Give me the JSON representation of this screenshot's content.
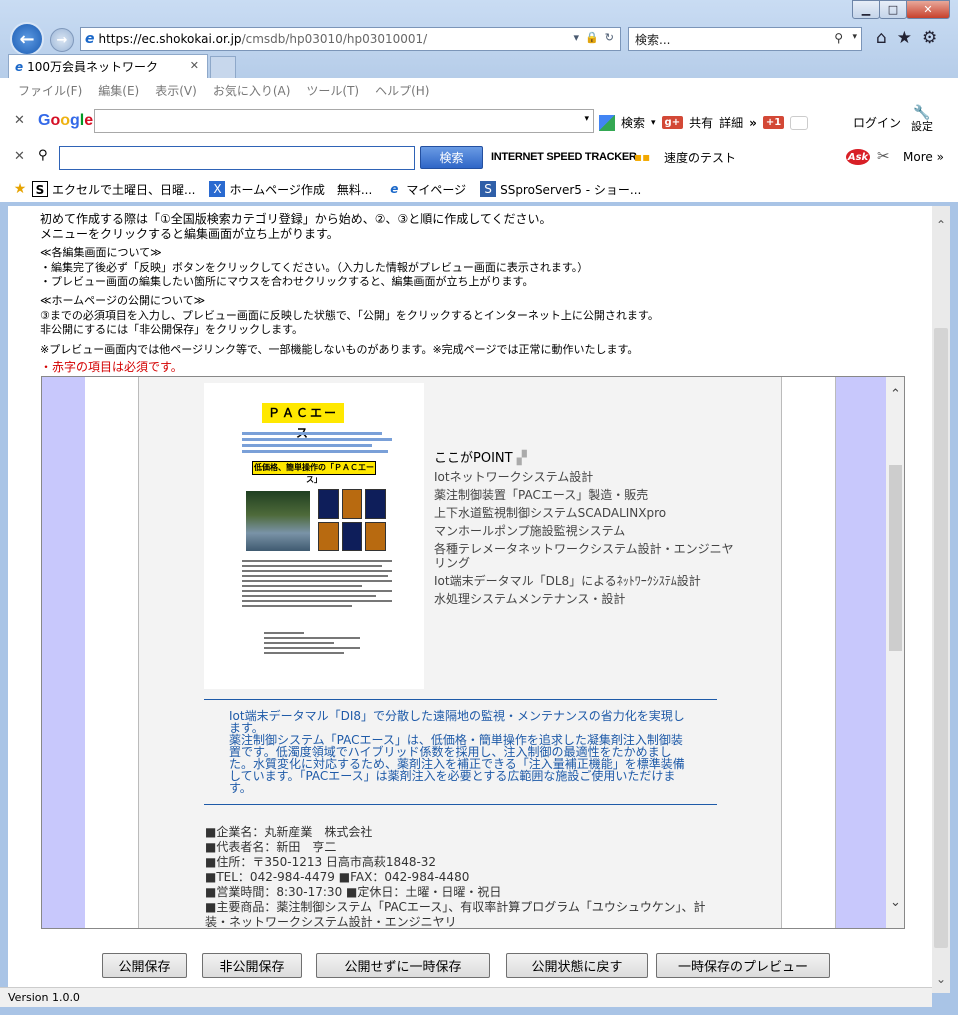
{
  "browser": {
    "url_host": "https://ec.shokokai.or.jp",
    "url_path": "/cmsdb/hp03010/hp03010001/",
    "search_placeholder": "検索...",
    "tab_title": "100万会員ネットワーク"
  },
  "menu": [
    "ファイル(F)",
    "編集(E)",
    "表示(V)",
    "お気に入り(A)",
    "ツール(T)",
    "ヘルプ(H)"
  ],
  "google_toolbar": {
    "logo": "Google",
    "search_label": "検索",
    "share_label": "共有",
    "details_label": "詳細",
    "gplus_label": "+1",
    "login_label": "ログイン",
    "settings_label": "設定"
  },
  "speed_toolbar": {
    "search_button": "検索",
    "title": "INTERNET SPEED TRACKER",
    "speed_test": "速度のテスト",
    "ask_logo": "Ask",
    "more": "More"
  },
  "favorites": [
    {
      "icon": "S",
      "label": "エクセルで土曜日、日曜..."
    },
    {
      "icon": "X",
      "label": "ホームページ作成　無料..."
    },
    {
      "icon": "e",
      "label": "マイページ"
    },
    {
      "icon": "S",
      "label": "SSproServer5 - ショー..."
    }
  ],
  "instructions": {
    "line1": "初めて作成する際は「①全国版検索カテゴリ登録」から始め、②、③と順に作成してください。",
    "line2": "メニューをクリックすると編集画面が立ち上がります。",
    "edit_head": "≪各編集画面について≫",
    "edit_1": "・編集完了後必ず「反映」ボタンをクリックしてください。（入力した情報がプレビュー画面に表示されます。）",
    "edit_2": "・プレビュー画面の編集したい箇所にマウスを合わせクリックすると、編集画面が立ち上がります。",
    "publish_head": "≪ホームページの公開について≫",
    "publish_1": "③までの必須項目を入力し、プレビュー画面に反映した状態で、「公開」をクリックするとインターネット上に公開されます。",
    "publish_2": "非公開にするには「非公開保存」をクリックします。",
    "note": "※プレビュー画面内では他ページリンク等で、一部機能しないものがあります。※完成ページでは正常に動作いたします。",
    "required": "・赤字の項目は必須です。"
  },
  "flyer": {
    "title": "ＰＡＣエース",
    "subtitle": "低価格、簡単操作の「ＰＡＣエース」"
  },
  "point": {
    "title": "ここがPOINT",
    "items": [
      "Iotネットワークシステム設計",
      "薬注制御装置「PACエース」製造・販売",
      "上下水道監視制御システムSCADALINXpro",
      "マンホールポンプ施設監視システム",
      "各種テレメータネットワークシステム設計・エンジニヤリング",
      "Iot端末データマル「DL8」によるﾈｯﾄﾜｰｸｼｽﾃﾑ設計",
      "水処理システムメンテナンス・設計"
    ]
  },
  "intro": {
    "p1": "Iot端末データマル「DI8」で分散した遠隔地の監視・メンテナンスの省力化を実現します。",
    "p2": "薬注制御システム「PACエース」は、低価格・簡単操作を追求した凝集剤注入制御装置です。低濁度領域でハイブリッド係数を採用し、注入制御の最適性をたかめました。水質変化に対応するため、薬剤注入を補正できる「注入量補正機能」を標準装備しています。「PACエース」は薬剤注入を必要とする広範囲な施設ご使用いただけます。"
  },
  "company": {
    "name": "■企業名：丸新産業　株式会社",
    "rep": "■代表者名：新田　亨二",
    "address": "■住所：〒350-1213 日高市高萩1848-32",
    "tel": "■TEL：042-984-4479 ■FAX：042-984-4480",
    "hours": "■営業時間：8:30-17:30 ■定休日：土曜・日曜・祝日",
    "products": "■主要商品：薬注制御システム「PACエース」、有収率計算プログラム「ユウシュウケン」、計装・ネットワークシステム設計・エンジニヤリ"
  },
  "buttons": {
    "publish_save": "公開保存",
    "private_save": "非公開保存",
    "temp_save": "公開せずに一時保存",
    "revert": "公開状態に戻す",
    "temp_preview": "一時保存のプレビュー"
  },
  "version": "Version 1.0.0"
}
